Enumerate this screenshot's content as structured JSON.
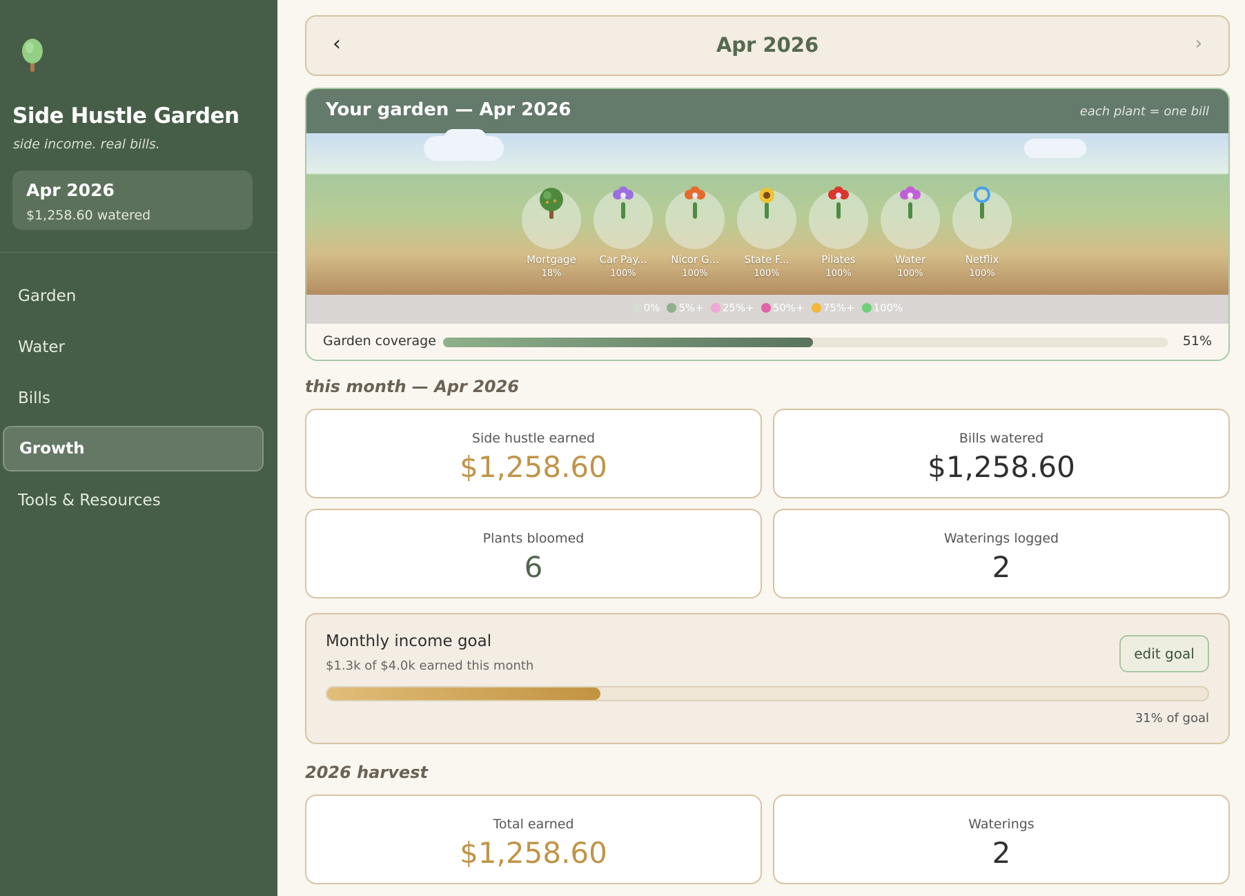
{
  "app": {
    "title": "Side Hustle Garden",
    "tagline": "side income. real bills.",
    "logo_icon": "tree-icon"
  },
  "sidebar": {
    "month_card": {
      "title": "Apr 2026",
      "subtitle": "$1,258.60 watered"
    },
    "nav": [
      {
        "label": "Garden",
        "active": false
      },
      {
        "label": "Water",
        "active": false
      },
      {
        "label": "Bills",
        "active": false
      },
      {
        "label": "Growth",
        "active": true
      },
      {
        "label": "Tools & Resources",
        "active": false
      }
    ]
  },
  "month_nav": {
    "prev_icon": "‹",
    "next_icon": "›",
    "label": "Apr 2026"
  },
  "garden": {
    "title": "Your garden — Apr 2026",
    "note": "each plant = one bill",
    "plants": [
      {
        "name": "Mortgage",
        "percent": "18%",
        "kind": "tree",
        "color": "#4e8a3e"
      },
      {
        "name": "Car Pay...",
        "percent": "100%",
        "kind": "flower",
        "color": "#9a6fe0"
      },
      {
        "name": "Nicor G...",
        "percent": "100%",
        "kind": "flower",
        "color": "#e46b2c"
      },
      {
        "name": "State F...",
        "percent": "100%",
        "kind": "sunflower",
        "color": "#f1c232"
      },
      {
        "name": "Pilates",
        "percent": "100%",
        "kind": "flower",
        "color": "#d9372d"
      },
      {
        "name": "Water",
        "percent": "100%",
        "kind": "flower",
        "color": "#c15fd8"
      },
      {
        "name": "Netflix",
        "percent": "100%",
        "kind": "ring",
        "color": "#4aa3e8"
      }
    ],
    "legend": [
      {
        "label": "0%",
        "color": "#d5dcd0"
      },
      {
        "label": "5%+",
        "color": "#8fb08b"
      },
      {
        "label": "25%+",
        "color": "#f0a8d6"
      },
      {
        "label": "50%+",
        "color": "#e163a8"
      },
      {
        "label": "75%+",
        "color": "#f3b73a"
      },
      {
        "label": "100%",
        "color": "#6fd07a"
      }
    ],
    "coverage": {
      "label": "Garden coverage",
      "value": "51%",
      "fraction": 0.51
    }
  },
  "this_month": {
    "heading": "this month — Apr 2026",
    "stats": [
      {
        "label": "Side hustle earned",
        "value": "$1,258.60"
      },
      {
        "label": "Bills watered",
        "value": "$1,258.60"
      },
      {
        "label": "Plants bloomed",
        "value": "6"
      },
      {
        "label": "Waterings logged",
        "value": "2"
      }
    ]
  },
  "goal": {
    "title": "Monthly income goal",
    "subtitle": "$1.3k of $4.0k earned this month",
    "button": "edit goal",
    "percent_label": "31% of goal",
    "fraction": 0.31
  },
  "harvest": {
    "heading": "2026 harvest",
    "stats": [
      {
        "label": "Total earned",
        "value": "$1,258.60"
      },
      {
        "label": "Waterings",
        "value": "2"
      }
    ]
  }
}
